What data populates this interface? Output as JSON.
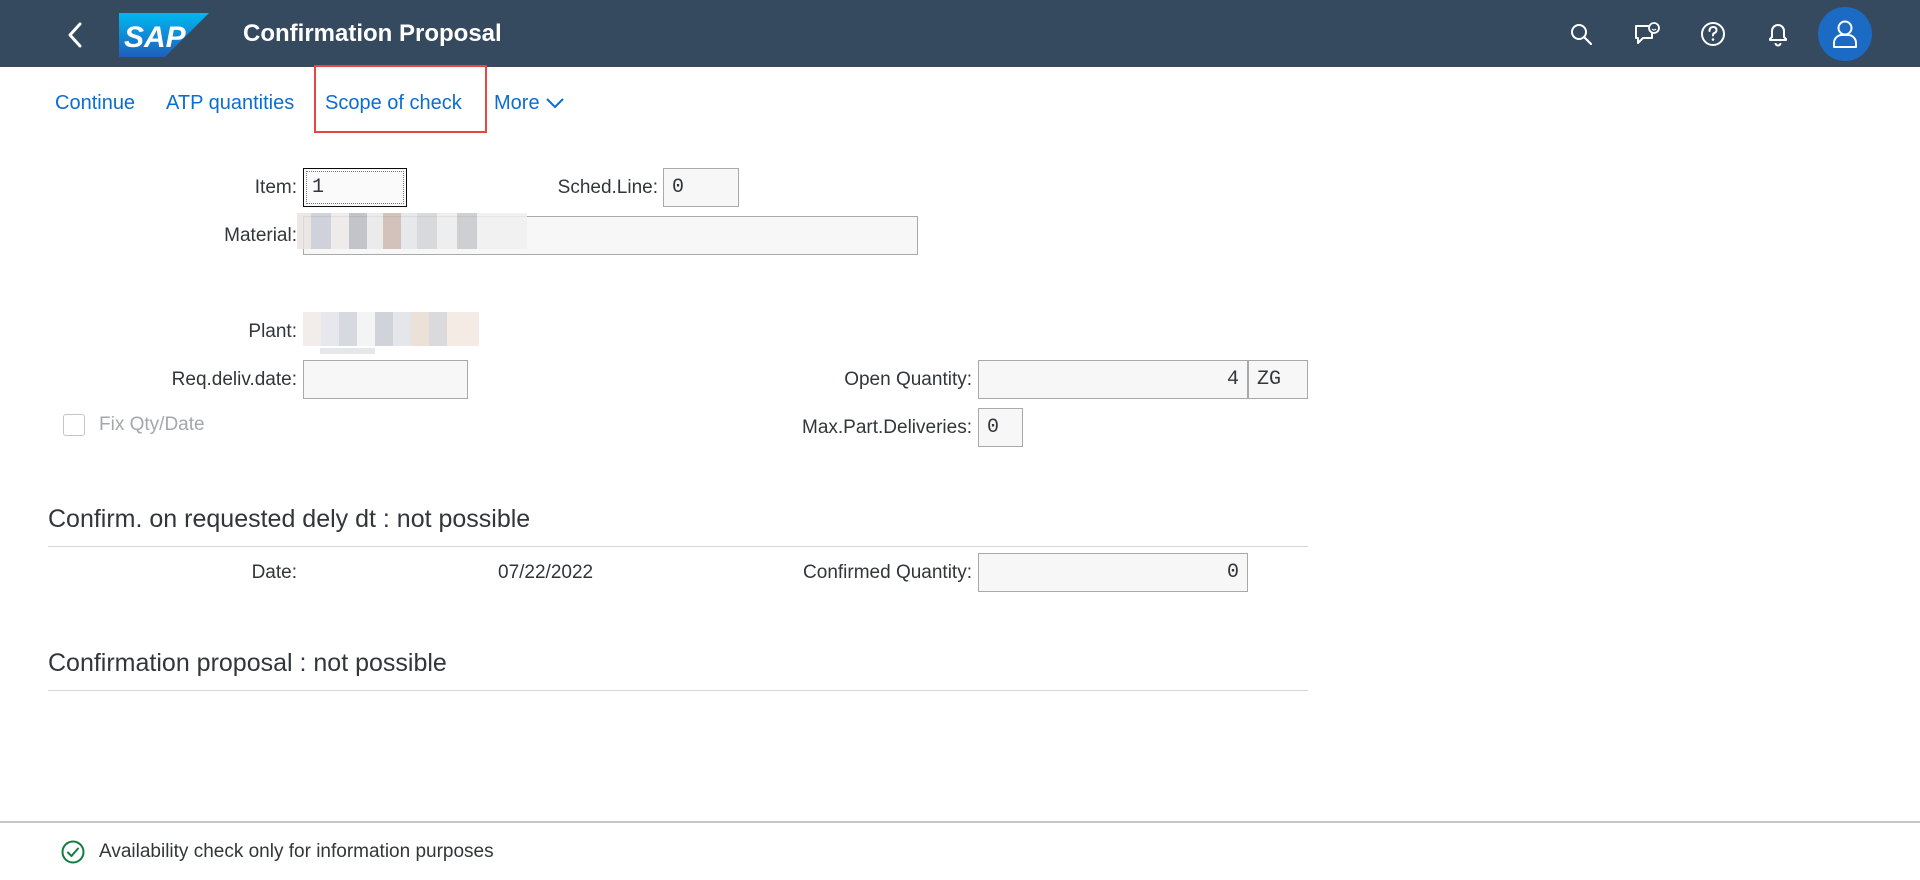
{
  "shell": {
    "title": "Confirmation Proposal",
    "logo_text": "SAP"
  },
  "toolbar": {
    "continue": "Continue",
    "atp_quantities": "ATP quantities",
    "scope_of_check": "Scope of check",
    "more": "More"
  },
  "form": {
    "item_label": "Item:",
    "item_value": "1",
    "sched_line_label": "Sched.Line:",
    "sched_line_value": "0",
    "material_label": "Material:",
    "material_value": "",
    "plant_label": "Plant:",
    "req_deliv_date_label": "Req.deliv.date:",
    "req_deliv_date_value": "",
    "open_quantity_label": "Open Quantity:",
    "open_quantity_value": "4",
    "open_quantity_unit": "ZG",
    "fix_qty_date_label": "Fix Qty/Date",
    "max_part_deliveries_label": "Max.Part.Deliveries:",
    "max_part_deliveries_value": "0"
  },
  "section1": {
    "title": "Confirm. on requested dely dt : not possible",
    "date_label": "Date:",
    "date_value": "07/22/2022",
    "confirmed_quantity_label": "Confirmed Quantity:",
    "confirmed_quantity_value": "0"
  },
  "section2": {
    "title": "Confirmation proposal : not possible"
  },
  "footer": {
    "message": "Availability check only for information purposes"
  },
  "colors": {
    "shell_bg": "#354a5f",
    "link": "#0a6ed1",
    "highlight": "#e8463f",
    "success": "#107e3e",
    "avatar_bg": "#1b6ac4"
  },
  "icons": [
    "back-icon",
    "search-icon",
    "feedback-chat-icon",
    "help-icon",
    "notification-bell-icon",
    "user-icon",
    "chevron-down-icon",
    "success-check-icon"
  ]
}
